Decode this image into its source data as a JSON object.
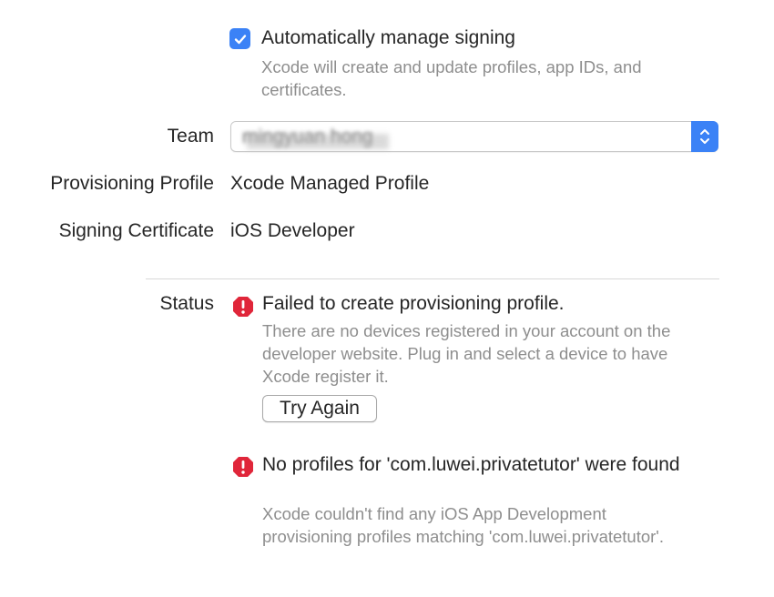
{
  "signing": {
    "auto_manage_label": "Automatically manage signing",
    "auto_manage_checked": true,
    "auto_manage_help": "Xcode will create and update profiles, app IDs, and certificates.",
    "team_label": "Team",
    "team_value": "mingyuan hong",
    "provisioning_label": "Provisioning Profile",
    "provisioning_value": "Xcode Managed Profile",
    "certificate_label": "Signing Certificate",
    "certificate_value": "iOS Developer"
  },
  "status": {
    "label": "Status",
    "errors": [
      {
        "title": "Failed to create provisioning profile.",
        "detail": "There are no devices registered in your account on the developer website. Plug in and select a device to have Xcode register it.",
        "action_label": "Try Again"
      },
      {
        "title": "No profiles for 'com.luwei.privatetutor' were found",
        "detail": "Xcode couldn't find any iOS App Development provisioning profiles matching 'com.luwei.privatetutor'."
      }
    ]
  },
  "colors": {
    "accent": "#3b82f6",
    "error": "#e0263a"
  }
}
